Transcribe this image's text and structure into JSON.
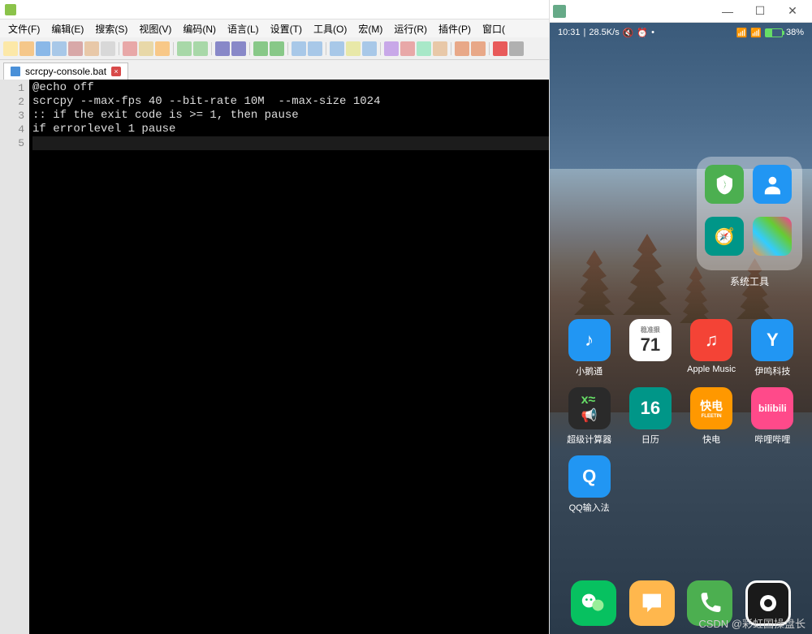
{
  "npp": {
    "title": "",
    "menus": [
      "文件(F)",
      "编辑(E)",
      "搜索(S)",
      "视图(V)",
      "编码(N)",
      "语言(L)",
      "设置(T)",
      "工具(O)",
      "宏(M)",
      "运行(R)",
      "插件(P)",
      "窗口("
    ],
    "tab": {
      "filename": "scrcpy-console.bat"
    },
    "lines": [
      "@echo off",
      "scrcpy --max-fps 40 --bit-rate 10M  --max-size 1024",
      ":: if the exit code is >= 1, then pause",
      "if errorlevel 1 pause",
      ""
    ]
  },
  "scrcpy": {
    "title": ""
  },
  "phone": {
    "status": {
      "time": "10:31",
      "net_speed": "28.5K/s",
      "battery_pct": "38%"
    },
    "folder_label": "系统工具",
    "apps_row1": [
      {
        "label": "小鹅通",
        "cls": "c-blue",
        "glyph": "♪"
      },
      {
        "label": "",
        "cls": "c-white",
        "glyph": "71",
        "sub": "稳准狠"
      },
      {
        "label": "Apple Music",
        "cls": "c-red",
        "glyph": "♫"
      },
      {
        "label": "伊鸣科技",
        "cls": "c-blue",
        "glyph": "Y"
      }
    ],
    "apps_row2": [
      {
        "label": "超级计算器",
        "cls": "c-dark",
        "glyph": "x≈"
      },
      {
        "label": "日历",
        "cls": "c-teal",
        "glyph": "16"
      },
      {
        "label": "快电",
        "cls": "c-orange",
        "glyph": "快电",
        "sub": "FLEETIN"
      },
      {
        "label": "哔哩哔哩",
        "cls": "c-pink",
        "glyph": "bili"
      }
    ],
    "apps_row3": [
      {
        "label": "QQ输入法",
        "cls": "c-blue",
        "glyph": "Q"
      }
    ],
    "dock": [
      {
        "name": "wechat",
        "cls": "c-wechat",
        "glyph": "💬"
      },
      {
        "name": "messages",
        "cls": "c-yellow",
        "glyph": "💬"
      },
      {
        "name": "phone",
        "cls": "c-phone",
        "glyph": "📞"
      },
      {
        "name": "camera",
        "cls": "c-camera",
        "glyph": "◉"
      }
    ]
  },
  "watermark": "CSDN @彩虹国操盘长"
}
